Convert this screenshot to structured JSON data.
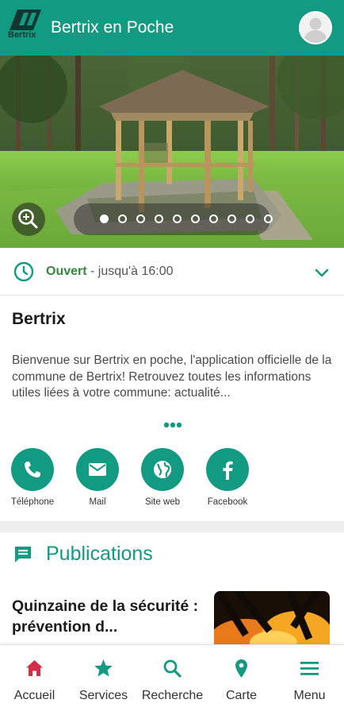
{
  "header": {
    "title": "Bertrix en Poche",
    "logo_text": "Bertrix",
    "avatar_icon": "user-avatar-icon"
  },
  "hero": {
    "slide_count": 10,
    "active_slide": 1,
    "zoom_icon": "zoom-in-icon"
  },
  "hours": {
    "status": "Ouvert",
    "detail": " - jusqu'à 16:00",
    "status_color": "#2f8a3d"
  },
  "place": {
    "name": "Bertrix",
    "description": "Bienvenue sur Bertrix en poche, l'application officielle de la commune de Bertrix! Retrouvez toutes les informations utiles liées à votre commune: actualité..."
  },
  "contacts": [
    {
      "label": "Téléphone",
      "icon": "phone-icon"
    },
    {
      "label": "Mail",
      "icon": "mail-icon"
    },
    {
      "label": "Site web",
      "icon": "globe-icon"
    },
    {
      "label": "Facebook",
      "icon": "facebook-icon"
    }
  ],
  "publications": {
    "title": "Publications",
    "card": {
      "title": "Quinzaine de la sécurité : prévention d..."
    }
  },
  "bottom_nav": [
    {
      "label": "Accueil",
      "icon": "home-icon",
      "active": true
    },
    {
      "label": "Services",
      "icon": "star-icon"
    },
    {
      "label": "Recherche",
      "icon": "search-icon"
    },
    {
      "label": "Carte",
      "icon": "map-pin-icon"
    },
    {
      "label": "Menu",
      "icon": "menu-icon"
    }
  ],
  "colors": {
    "brand": "#139a83",
    "active_nav": "#d32f4a"
  }
}
